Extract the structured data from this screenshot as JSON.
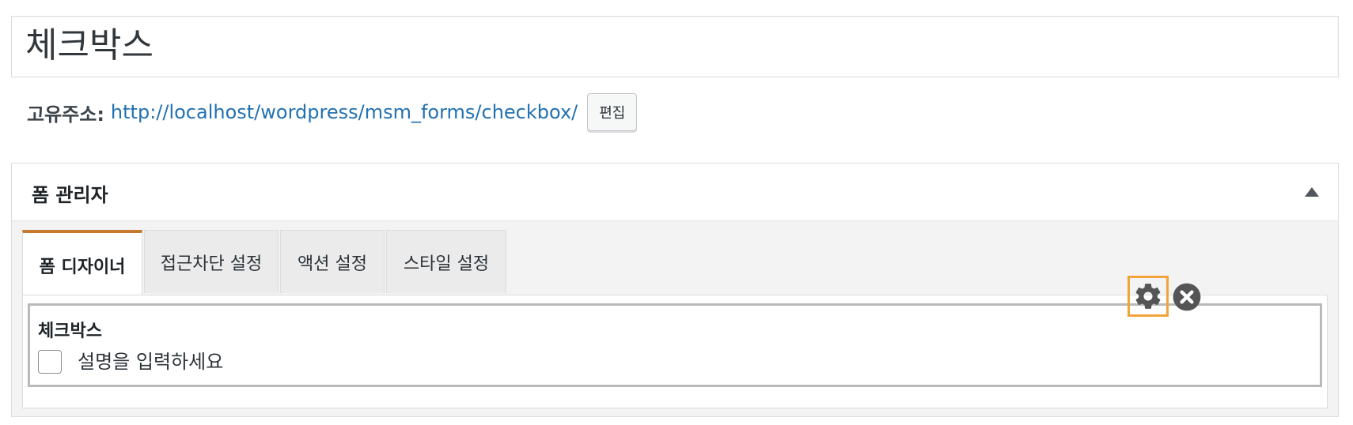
{
  "post": {
    "title": "체크박스",
    "permalink_label": "고유주소:",
    "permalink_url": "http://localhost/wordpress/msm_forms/checkbox/",
    "edit_label": "편집"
  },
  "metabox": {
    "title": "폼 관리자",
    "tabs": [
      {
        "label": "폼 디자이너",
        "active": true
      },
      {
        "label": "접근차단 설정",
        "active": false
      },
      {
        "label": "액션 설정",
        "active": false
      },
      {
        "label": "스타일 설정",
        "active": false
      }
    ]
  },
  "field": {
    "title": "체크박스",
    "description": "설명을 입력하세요",
    "checked": false,
    "settings_icon": "gear-icon",
    "remove_icon": "close-circle-icon"
  },
  "colors": {
    "active_tab_accent": "#c7792f",
    "highlight": "#f2a33a",
    "link": "#2271b1",
    "icon": "#555555"
  }
}
